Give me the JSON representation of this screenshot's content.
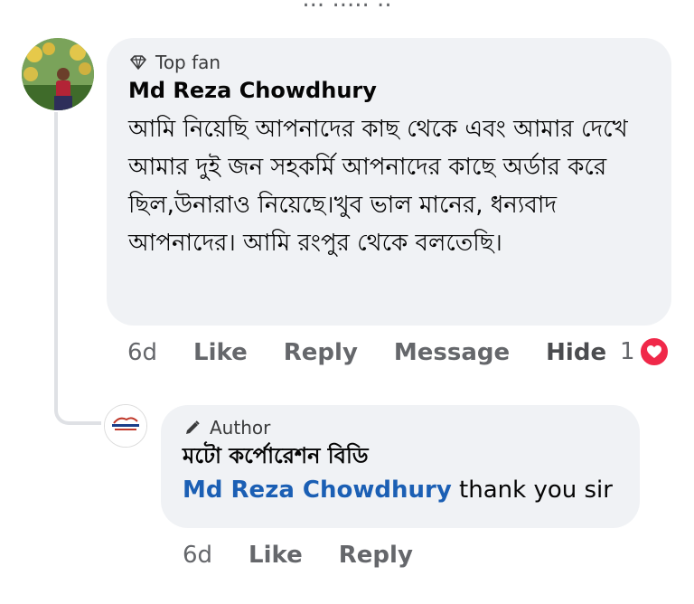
{
  "top_cutoff": "... ..... ..",
  "comment": {
    "badge_label": "Top fan",
    "badge_icon": "diamond-icon",
    "author": "Md Reza Chowdhury",
    "text": "আমি নিয়েছি আপনাদের কাছ থেকে এবং আমার দেখে আমার দুই জন সহকর্মি আপনাদের কাছে অর্ডার করে ছিল,উনারাও নিয়েছে।খুব ভাল মানের, ধন্যবাদ আপনাদের। আমি রংপুর থেকে বলতেছি।",
    "actions": {
      "time": "6d",
      "like": "Like",
      "reply": "Reply",
      "message": "Message",
      "hide": "Hide"
    },
    "reaction_count": "1",
    "reaction_icon": "heart-icon",
    "reaction_color": "#f02849"
  },
  "reply": {
    "badge_label": "Author",
    "badge_icon": "pencil-icon",
    "author": "মটো কর্পোরেশন বিডি",
    "mention": "Md Reza Chowdhury",
    "text": " thank you sir",
    "actions": {
      "time": "6d",
      "like": "Like",
      "reply": "Reply"
    }
  },
  "colors": {
    "bubble_bg": "#f0f2f5",
    "mention": "#1b5fb4",
    "meta_text": "#65676b",
    "thread_line": "#dfe1e5"
  }
}
